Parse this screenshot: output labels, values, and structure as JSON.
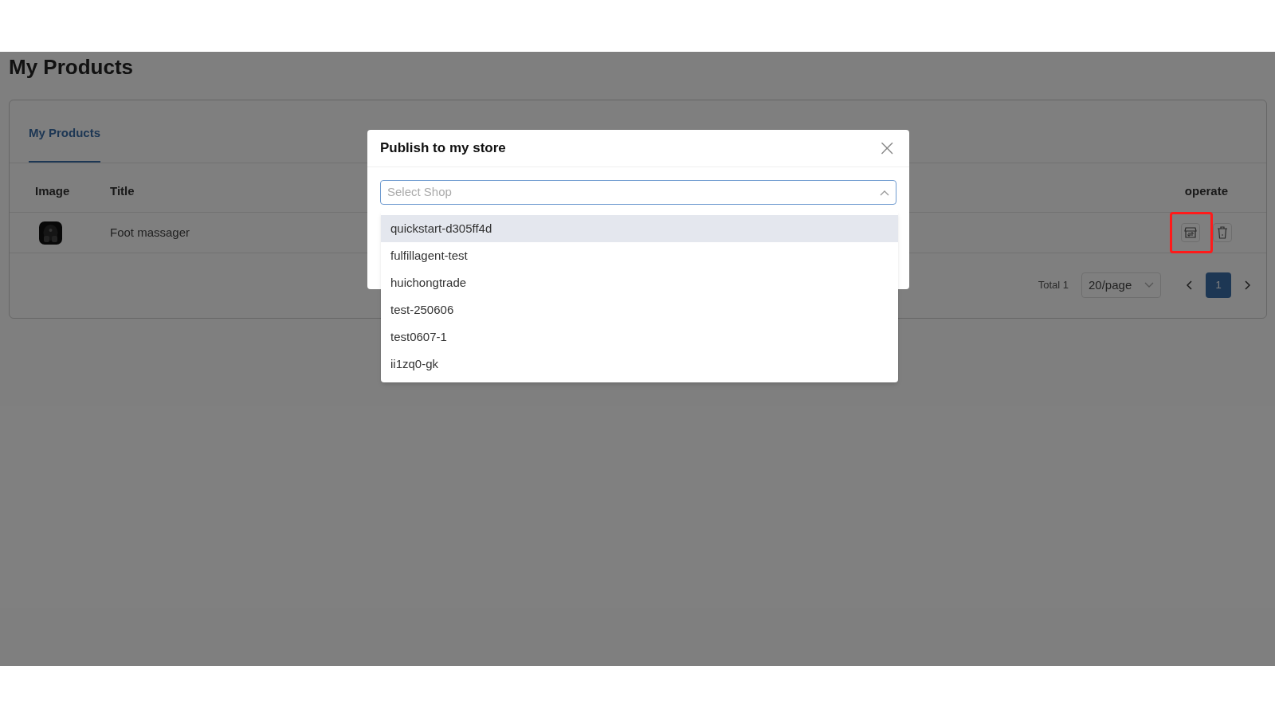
{
  "page": {
    "title": "My Products"
  },
  "tabs": [
    {
      "label": "My Products",
      "selected": true
    }
  ],
  "table": {
    "columns": [
      "Image",
      "Title",
      "operate"
    ],
    "rows": [
      {
        "image": {
          "kind": "picture"
        },
        "title": "Foot massager",
        "actions": [
          {
            "kind": "publish",
            "highlighted": true
          },
          {
            "kind": "delete"
          }
        ]
      }
    ]
  },
  "pagination": {
    "total": "Total 1",
    "page_size": "20/page",
    "pages": [
      {
        "label": "1",
        "selected": true
      }
    ]
  },
  "dialog": {
    "title": "Publish to my store",
    "close": "×",
    "select": {
      "placeholder": "Select Shop",
      "expanded": true
    },
    "options": [
      {
        "label": "quickstart-d305ff4d",
        "selected": true
      },
      {
        "label": "fulfillagent-test",
        "selected": false
      },
      {
        "label": "huichongtrade",
        "selected": false
      },
      {
        "label": "test-250606",
        "selected": false
      },
      {
        "label": "test0607-1",
        "selected": false
      },
      {
        "label": "ii1zq0-gk",
        "selected": false
      }
    ]
  }
}
